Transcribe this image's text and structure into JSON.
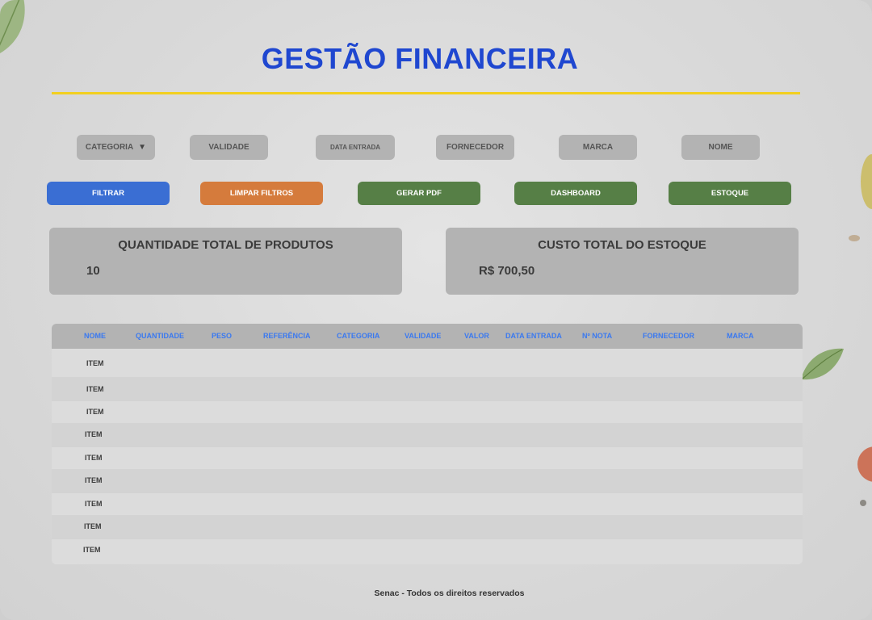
{
  "header": {
    "title": "GESTÃO FINANCEIRA"
  },
  "filters": {
    "categoria": "CATEGORIA",
    "validade": "VALIDADE",
    "data_entrada": "DATA ENTRADA",
    "fornecedor": "FORNECEDOR",
    "marca": "MARCA",
    "nome": "NOME"
  },
  "actions": {
    "filtrar": "FILTRAR",
    "limpar_filtros": "LIMPAR FILTROS",
    "gerar_pdf": "GERAR PDF",
    "dashboard": "DASHBOARD",
    "estoque": "ESTOQUE"
  },
  "summary": {
    "quantidade_label": "QUANTIDADE TOTAL DE PRODUTOS",
    "quantidade_value": "10",
    "custo_label": "CUSTO TOTAL DO ESTOQUE",
    "custo_value": "R$ 700,50"
  },
  "table": {
    "columns": [
      "NOME",
      "QUANTIDADE",
      "PESO",
      "REFERÊNCIA",
      "CATEGORIA",
      "VALIDADE",
      "VALOR",
      "DATA ENTRADA",
      "Nº NOTA",
      "FORNECEDOR",
      "MARCA"
    ],
    "rows": [
      "ITEM",
      "ITEM",
      "ITEM",
      "ITEM",
      "ITEM",
      "ITEM",
      "ITEM",
      "ITEM",
      "ITEM"
    ]
  },
  "footer": {
    "text": "Senac - Todos os direitos reservados"
  },
  "colors": {
    "title": "#1f47d0",
    "rule": "#f2cf1f",
    "filtrar": "#3a6ed3",
    "limpar": "#d57b3c",
    "green": "#567f46",
    "column_header_text": "#3a79f0"
  },
  "icons": {
    "dropdown": "caret-down-icon"
  }
}
